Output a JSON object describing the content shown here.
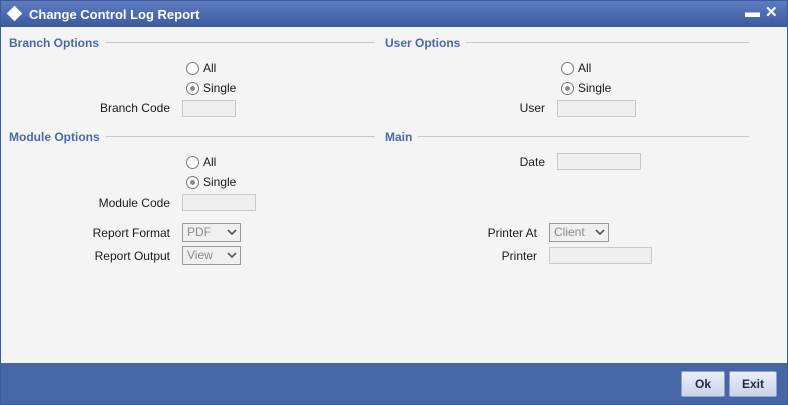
{
  "window": {
    "title": "Change Control Log Report",
    "minimize": "▬",
    "close": "✕"
  },
  "branch_options": {
    "heading": "Branch Options",
    "radio_all": "All",
    "radio_single": "Single",
    "code_label": "Branch Code",
    "code_value": ""
  },
  "user_options": {
    "heading": "User Options",
    "radio_all": "All",
    "radio_single": "Single",
    "user_label": "User",
    "user_value": ""
  },
  "module_options": {
    "heading": "Module Options",
    "radio_all": "All",
    "radio_single": "Single",
    "code_label": "Module Code",
    "code_value": ""
  },
  "main": {
    "heading": "Main",
    "date_label": "Date",
    "date_value": ""
  },
  "report": {
    "format_label": "Report Format",
    "format_value": "PDF",
    "output_label": "Report Output",
    "output_value": "View",
    "printer_at_label": "Printer At",
    "printer_at_value": "Client",
    "printer_label": "Printer",
    "printer_value": ""
  },
  "footer": {
    "ok_label": "Ok",
    "exit_label": "Exit"
  },
  "colors": {
    "title_bar": "#4766a6",
    "section_heading": "#4a6aa5",
    "footer": "#4766a6"
  }
}
